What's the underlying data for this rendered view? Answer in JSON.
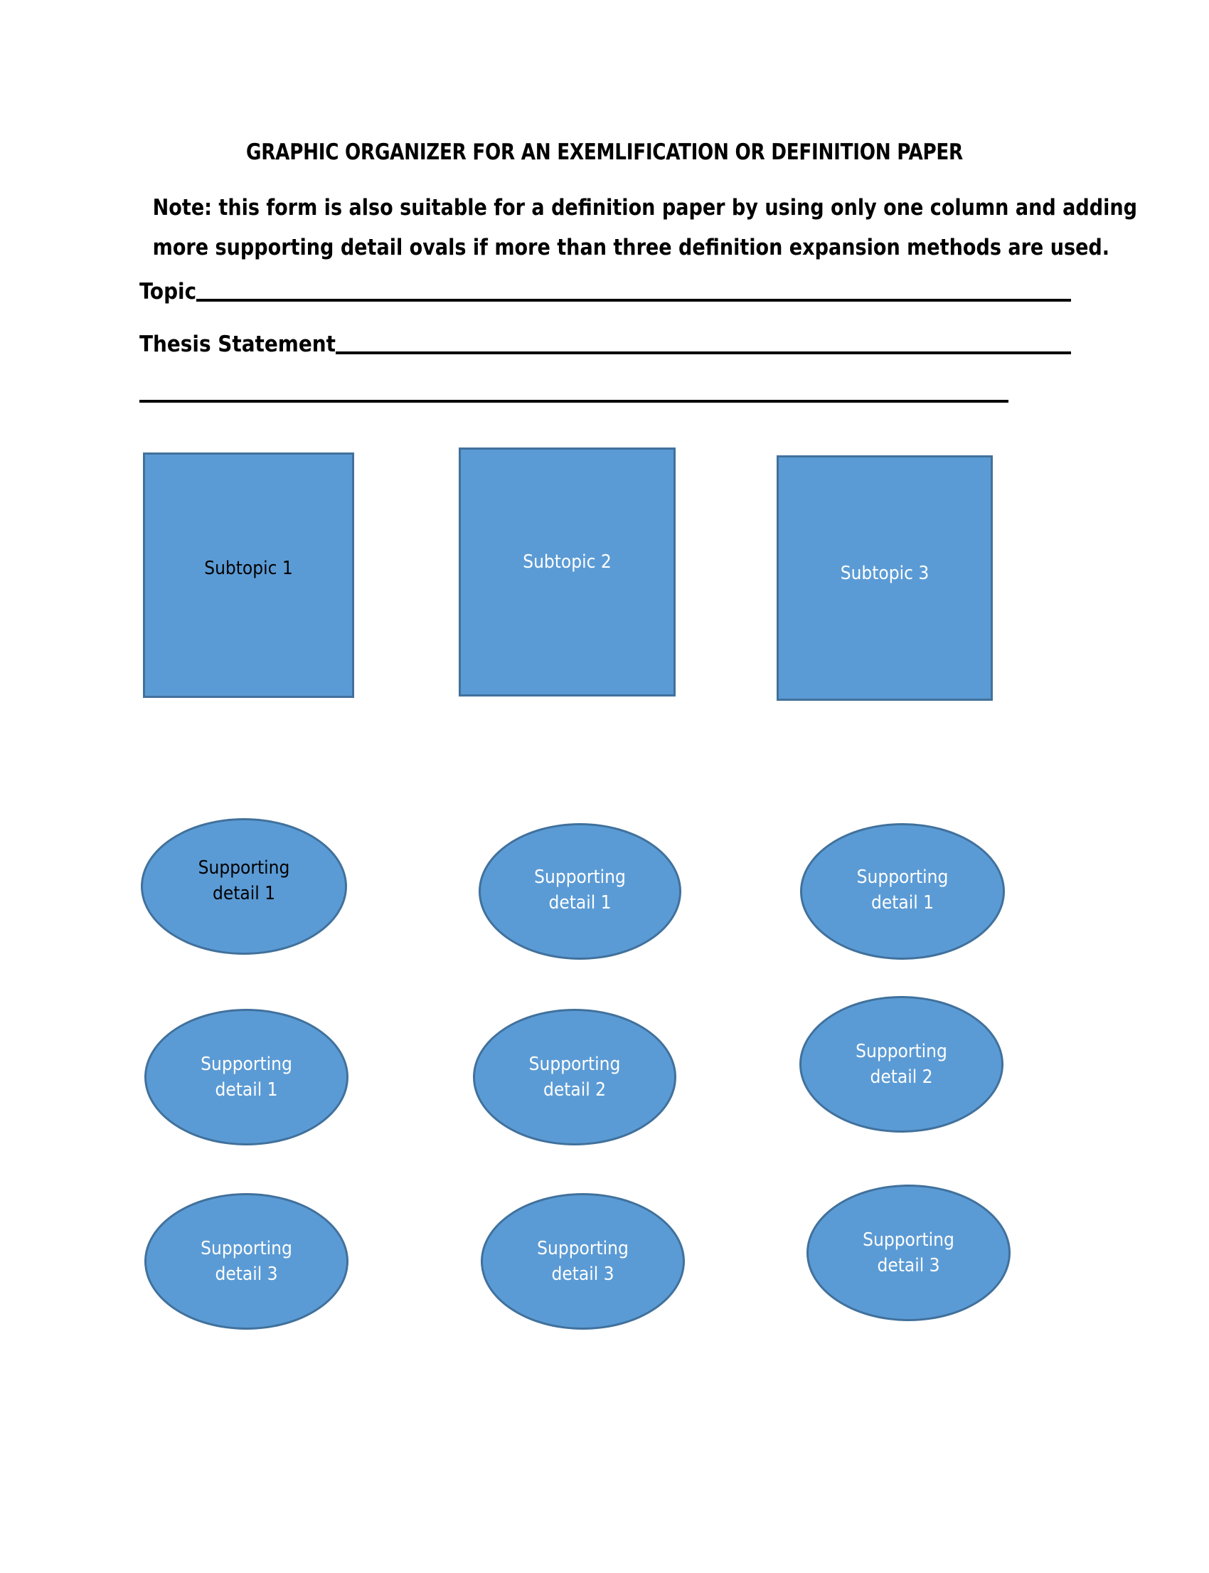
{
  "document": {
    "title": "GRAPHIC ORGANIZER FOR AN EXEMLIFICATION OR DEFINITION PAPER",
    "note_line_1": "Note: this form is also suitable for a definition paper by using only one column and adding",
    "note_line_2": "more supporting detail ovals if more than three definition expansion methods are used."
  },
  "fields": [
    {
      "label": "Topic",
      "value": ""
    },
    {
      "label": "Thesis Statement",
      "value": ""
    }
  ],
  "colors": {
    "shape_fill": "#5B9BD5",
    "shape_border": "#41719C",
    "text_dark": "#000000",
    "text_light": "#FFFFFF",
    "rule": "#000000"
  },
  "organizer": {
    "subtopics": [
      {
        "label": "Subtopic 1",
        "text_color": "dark"
      },
      {
        "label": "Subtopic 2",
        "text_color": "light"
      },
      {
        "label": "Subtopic 3",
        "text_color": "light"
      }
    ],
    "supporting_details": {
      "row_1": [
        {
          "line_1": "Supporting",
          "line_2": "detail 1",
          "text_color": "dark"
        },
        {
          "line_1": "Supporting",
          "line_2": "detail 1",
          "text_color": "light"
        },
        {
          "line_1": "Supporting",
          "line_2": "detail 1",
          "text_color": "light"
        }
      ],
      "row_2": [
        {
          "line_1": "Supporting",
          "line_2": "detail 1",
          "text_color": "light"
        },
        {
          "line_1": "Supporting",
          "line_2": "detail 2",
          "text_color": "light"
        },
        {
          "line_1": "Supporting",
          "line_2": "detail 2",
          "text_color": "light"
        }
      ],
      "row_3": [
        {
          "line_1": "Supporting",
          "line_2": "detail 3",
          "text_color": "light"
        },
        {
          "line_1": "Supporting",
          "line_2": "detail 3",
          "text_color": "light"
        },
        {
          "line_1": "Supporting",
          "line_2": "detail 3",
          "text_color": "light"
        }
      ]
    }
  }
}
